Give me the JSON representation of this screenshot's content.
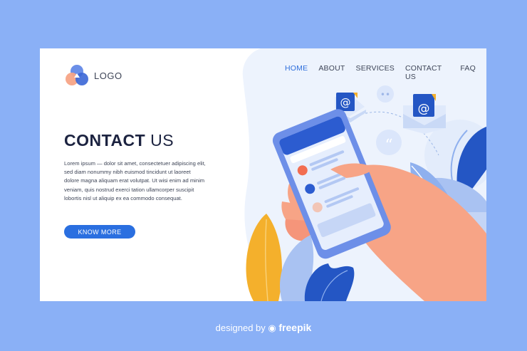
{
  "logo": {
    "text": "LOGO",
    "icon": "triangle-logo-icon"
  },
  "nav": {
    "items": [
      {
        "label": "HOME",
        "active": true
      },
      {
        "label": "ABOUT",
        "active": false
      },
      {
        "label": "SERVICES",
        "active": false
      },
      {
        "label": "CONTACT US",
        "active": false
      },
      {
        "label": "FAQ",
        "active": false
      }
    ]
  },
  "hero": {
    "title_bold": "CONTACT",
    "title_light": "US",
    "body": "Lorem ipsum — dolor sit amet, consectetuer adipiscing elit, sed diam nonummy nibh euismod tincidunt ut laoreet dolore magna aliquam erat volutpat. Ut wisi enim ad minim veniam, quis nostrud exerci tation ullamcorper suscipit lobortis nisl ut aliquip ex ea commodo consequat.",
    "cta_label": "KNOW MORE"
  },
  "footer": {
    "prefix": "designed by",
    "brand": "freepik"
  },
  "colors": {
    "background": "#8ab0f6",
    "accent": "#2a6fe0",
    "title": "#1c2340",
    "skin": "#f7a486",
    "leaf_yellow": "#f4b02c"
  }
}
